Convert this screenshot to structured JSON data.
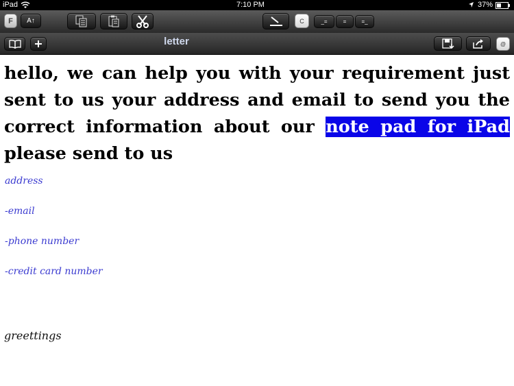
{
  "status": {
    "carrier": "iPad",
    "time": "7:10 PM",
    "battery": "37%"
  },
  "toolbar": {
    "font_label": "F",
    "size_label": "A↑",
    "color_label": "C",
    "align_left_label": "_=",
    "align_center_label": "=",
    "align_right_label": "=_",
    "email_label": "@"
  },
  "document": {
    "title": "letter",
    "body_start": "hello, we can help you with your requirement just sent to us your address and email to send you the correct information about our ",
    "highlight": "note pad for iPad ",
    "body_end": " please send to us",
    "fields": [
      "address",
      "-email",
      "-phone number",
      "-credit card number"
    ],
    "closing": "greettings"
  },
  "colors": {
    "highlight": "#0a05e8",
    "script_text": "#3a3ad0"
  },
  "icons": [
    "wifi-icon",
    "location-arrow-icon",
    "battery-icon",
    "copy-icon",
    "paste-icon",
    "scissors-icon",
    "pen-icon",
    "book-icon",
    "plus-icon",
    "save-icon",
    "share-icon"
  ]
}
